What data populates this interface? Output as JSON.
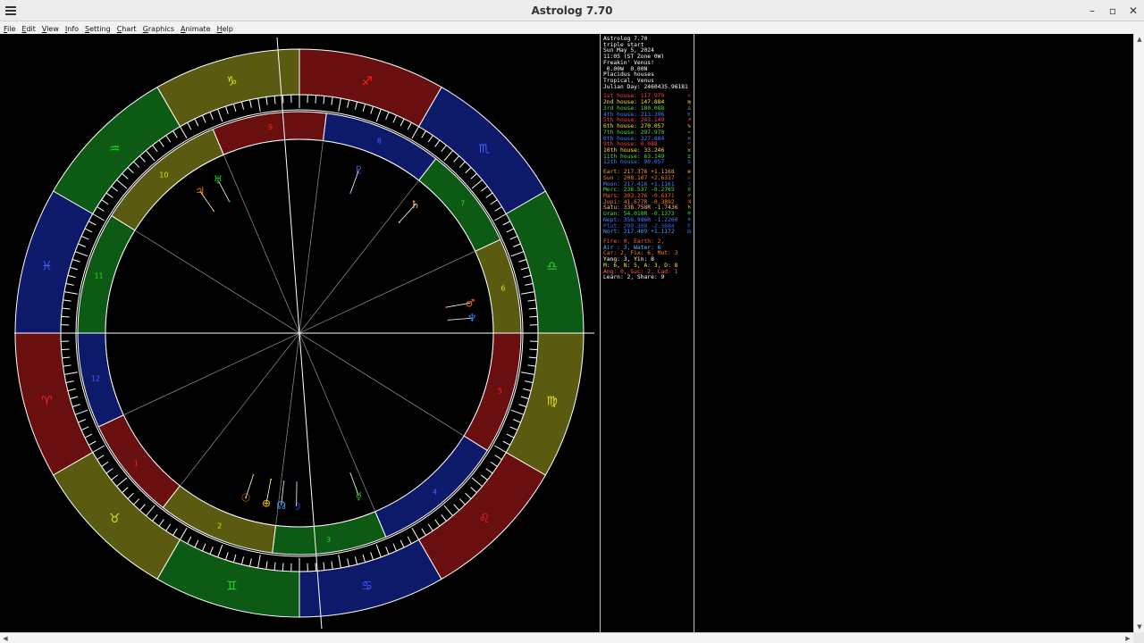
{
  "window": {
    "title": "Astrolog 7.70",
    "controls": {
      "minimize": "–",
      "maximize": "▫",
      "close": "✕"
    }
  },
  "menu": [
    {
      "key": "F",
      "rest": "ile"
    },
    {
      "key": "E",
      "rest": "dit"
    },
    {
      "key": "V",
      "rest": "iew"
    },
    {
      "key": "I",
      "rest": "nfo"
    },
    {
      "key": "S",
      "rest": "etting"
    },
    {
      "key": "C",
      "rest": "hart"
    },
    {
      "key": "G",
      "rest": "raphics"
    },
    {
      "key": "A",
      "rest": "nimate"
    },
    {
      "key": "H",
      "rest": "elp"
    }
  ],
  "wheel": {
    "signs": [
      "♈",
      "♉",
      "♊",
      "♋",
      "♌",
      "♍",
      "♎",
      "♏",
      "♐",
      "♑",
      "♒",
      "♓"
    ],
    "sign_colors": [
      "#ff2020",
      "#e0e020",
      "#20e020",
      "#4060ff"
    ],
    "houses": [
      "1",
      "2",
      "3",
      "4",
      "5",
      "6",
      "7",
      "8",
      "9",
      "10",
      "11",
      "12"
    ],
    "planets": [
      {
        "glyph": "☉",
        "color": "#ff7f00"
      },
      {
        "glyph": "⊕",
        "color": "#ffc000"
      },
      {
        "glyph": "☊",
        "color": "#40a0ff"
      },
      {
        "glyph": "☽",
        "color": "#4060ff"
      },
      {
        "glyph": "☿",
        "color": "#20c020"
      },
      {
        "glyph": "♂",
        "color": "#ff6000"
      },
      {
        "glyph": "♆",
        "color": "#4080ff"
      },
      {
        "glyph": "♄",
        "color": "#ffc060"
      },
      {
        "glyph": "♅",
        "color": "#20c020"
      },
      {
        "glyph": "♃",
        "color": "#ff7f00"
      },
      {
        "glyph": "♇",
        "color": "#4060ff"
      }
    ]
  },
  "info": {
    "header": [
      "Astrolog 7.70",
      "triple start",
      "Sun May 5, 2024",
      "11:05 (ST Zone 0W)",
      "Freakin' Venus!",
      " 0.00W  0.00N",
      "Placidus houses",
      "Tropical, Venus",
      "Julian Day: 2460435.96181"
    ],
    "houses": [
      {
        "label": "1st house:",
        "value": "117.970",
        "color": "#ff4040",
        "sym": "♌"
      },
      {
        "label": "2nd house:",
        "value": "147.884",
        "color": "#ffe020",
        "sym": "♍"
      },
      {
        "label": "3rd house:",
        "value": "180.088",
        "color": "#40e040",
        "sym": "♎"
      },
      {
        "label": "4th house:",
        "value": "213.396",
        "color": "#4080ff",
        "sym": "♏"
      },
      {
        "label": "5th house:",
        "value": "243.149",
        "color": "#ff4040",
        "sym": "♐"
      },
      {
        "label": "6th house:",
        "value": "270.057",
        "color": "#ffe020",
        "sym": "♑"
      },
      {
        "label": "7th house:",
        "value": "297.970",
        "color": "#40e040",
        "sym": "♒"
      },
      {
        "label": "8th house:",
        "value": "327.884",
        "color": "#4080ff",
        "sym": "♓"
      },
      {
        "label": "9th house:",
        "value": "0.088",
        "color": "#ff4040",
        "sym": "♈"
      },
      {
        "label": "10th house:",
        "value": "33.246",
        "color": "#ffe020",
        "sym": "♉"
      },
      {
        "label": "11th house:",
        "value": "63.149",
        "color": "#40e040",
        "sym": "♊"
      },
      {
        "label": "12th house:",
        "value": "90.057",
        "color": "#4080ff",
        "sym": "♋"
      }
    ],
    "planets": [
      {
        "label": "Eart:",
        "value": "217.376",
        "speed": "+1.1168",
        "color": "#ffa020",
        "sym": "⊕"
      },
      {
        "label": "Sun :",
        "value": "208.107",
        "speed": "+2.6317",
        "color": "#ff8020",
        "sym": "☉"
      },
      {
        "label": "Moon:",
        "value": "217.416",
        "speed": "+1.1161",
        "color": "#4080ff",
        "sym": "☽"
      },
      {
        "label": "Merc:",
        "value": "236.537",
        "speed": "-0.2765",
        "color": "#40e040",
        "sym": "☿"
      },
      {
        "label": "Mars:",
        "value": "303.276",
        "speed": "-0.6171",
        "color": "#ff6020",
        "sym": "♂"
      },
      {
        "label": "Jupi:",
        "value": "41.677R",
        "speed": "-0.3892",
        "color": "#ff8020",
        "sym": "♃"
      },
      {
        "label": "Satu:",
        "value": "338.758R",
        "speed": "-1.7436",
        "color": "#ffc060",
        "sym": "♄"
      },
      {
        "label": "Uran:",
        "value": "54.010R",
        "speed": "-0.1373",
        "color": "#40e040",
        "sym": "♅"
      },
      {
        "label": "Nept:",
        "value": "356.986R",
        "speed": "-1.2260",
        "color": "#4080ff",
        "sym": "♆"
      },
      {
        "label": "Plut:",
        "value": "299.308",
        "speed": "-2.3684",
        "color": "#4060ff",
        "sym": "♇"
      },
      {
        "label": "Nort:",
        "value": "217.409",
        "speed": "+1.1172",
        "color": "#40a0ff",
        "sym": "☊"
      }
    ],
    "summary": [
      {
        "text": "Fire: 0, Earth: 2,",
        "color": "#ff6040"
      },
      {
        "text": "Air : 3, Water: 6",
        "color": "#40c0ff"
      },
      {
        "text": "Car: 2, Fix: 6, Mut: 3",
        "color": "#ff8020"
      },
      {
        "text": "Yang: 3, Yin: 8",
        "color": "#ffffff"
      },
      {
        "text": "M: 6, N: 5, A: 3, D: 8",
        "color": "#ffe040"
      },
      {
        "text": "Ang: 0, Suc: 2, Cad: 1",
        "color": "#ff6040"
      },
      {
        "text": "Learn: 2, Share: 9",
        "color": "#ffffff"
      }
    ]
  }
}
